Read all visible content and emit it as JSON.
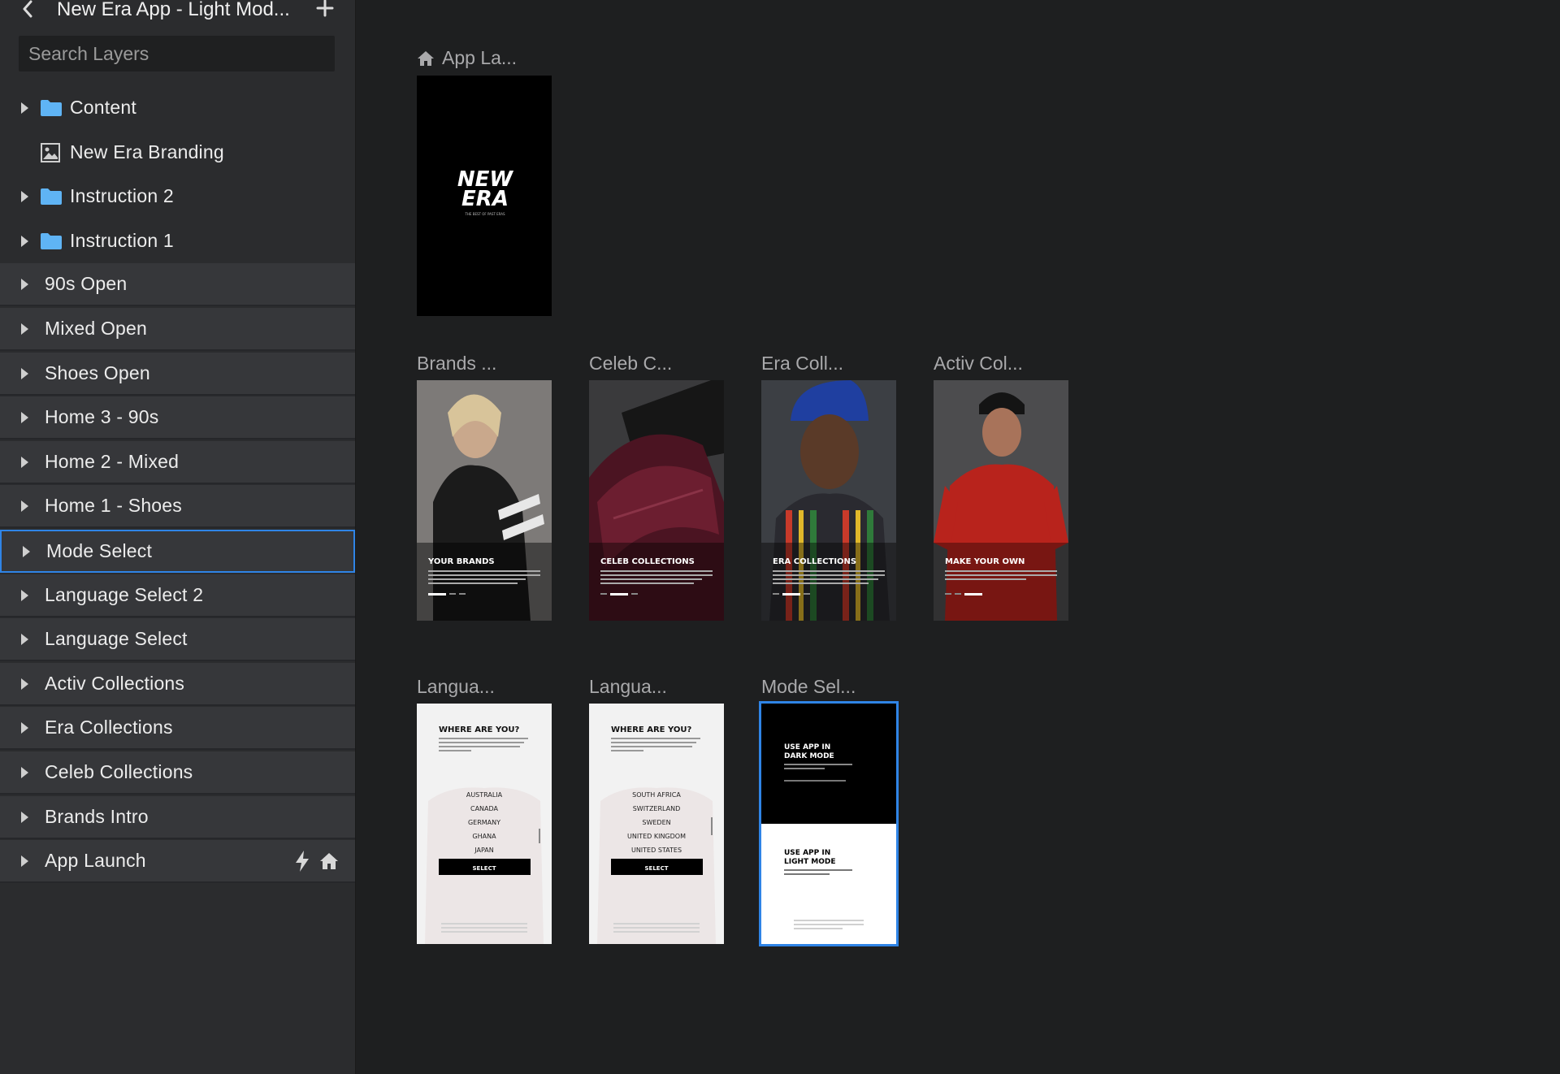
{
  "window": {
    "title": "New Era App - Light Mod...",
    "back_icon": "chevron-left-icon",
    "add_icon": "plus-icon"
  },
  "search": {
    "placeholder": "Search Layers",
    "value": ""
  },
  "layers": [
    {
      "label": "Content",
      "icon": "folder-icon",
      "expandable": true,
      "level": "child"
    },
    {
      "label": "New Era Branding",
      "icon": "image-icon",
      "expandable": false,
      "level": "child"
    },
    {
      "label": "Instruction 2",
      "icon": "folder-icon",
      "expandable": true,
      "level": "child"
    },
    {
      "label": "Instruction 1",
      "icon": "folder-icon",
      "expandable": true,
      "level": "child"
    },
    {
      "label": "90s Open",
      "expandable": true,
      "level": "top"
    },
    {
      "label": "Mixed Open",
      "expandable": true,
      "level": "top"
    },
    {
      "label": "Shoes Open",
      "expandable": true,
      "level": "top"
    },
    {
      "label": "Home 3 - 90s",
      "expandable": true,
      "level": "top"
    },
    {
      "label": "Home 2 - Mixed",
      "expandable": true,
      "level": "top"
    },
    {
      "label": "Home 1 - Shoes",
      "expandable": true,
      "level": "top"
    },
    {
      "label": "Mode Select",
      "expandable": true,
      "level": "top",
      "selected": true
    },
    {
      "label": "Language Select 2",
      "expandable": true,
      "level": "top"
    },
    {
      "label": "Language Select",
      "expandable": true,
      "level": "top"
    },
    {
      "label": "Activ Collections",
      "expandable": true,
      "level": "top"
    },
    {
      "label": "Era Collections",
      "expandable": true,
      "level": "top"
    },
    {
      "label": "Celeb Collections",
      "expandable": true,
      "level": "top"
    },
    {
      "label": "Brands Intro",
      "expandable": true,
      "level": "top"
    },
    {
      "label": "App Launch",
      "expandable": true,
      "level": "top",
      "badges": [
        "bolt-icon",
        "home-icon"
      ]
    }
  ],
  "artboards": {
    "launch": {
      "title": "App La...",
      "logo_line1": "NEW",
      "logo_line2": "ERA",
      "tagline": "THE BEST OF PAST ERAS"
    },
    "brands": {
      "title": "Brands ...",
      "heading": "YOUR BRANDS"
    },
    "celeb": {
      "title": "Celeb C...",
      "heading": "CELEB COLLECTIONS"
    },
    "era": {
      "title": "Era Coll...",
      "heading": "ERA COLLECTIONS"
    },
    "activ": {
      "title": "Activ Col...",
      "heading": "MAKE YOUR OWN"
    },
    "lang1": {
      "title": "Langua...",
      "heading": "WHERE ARE YOU?",
      "options": [
        "AUSTRALIA",
        "CANADA",
        "GERMANY",
        "GHANA",
        "JAPAN"
      ],
      "button": "SELECT"
    },
    "lang2": {
      "title": "Langua...",
      "heading": "WHERE ARE YOU?",
      "options": [
        "SOUTH AFRICA",
        "SWITZERLAND",
        "SWEDEN",
        "UNITED KINGDOM",
        "UNITED STATES"
      ],
      "button": "SELECT"
    },
    "mode": {
      "title": "Mode Sel...",
      "dark_line1": "USE APP IN",
      "dark_line2": "DARK MODE",
      "light_line1": "USE APP IN",
      "light_line2": "LIGHT MODE"
    }
  },
  "colors": {
    "accent": "#2f84e6",
    "folder": "#5fb4f5",
    "canvas": "#1e1f20",
    "sidebar": "#2b2c2e"
  }
}
